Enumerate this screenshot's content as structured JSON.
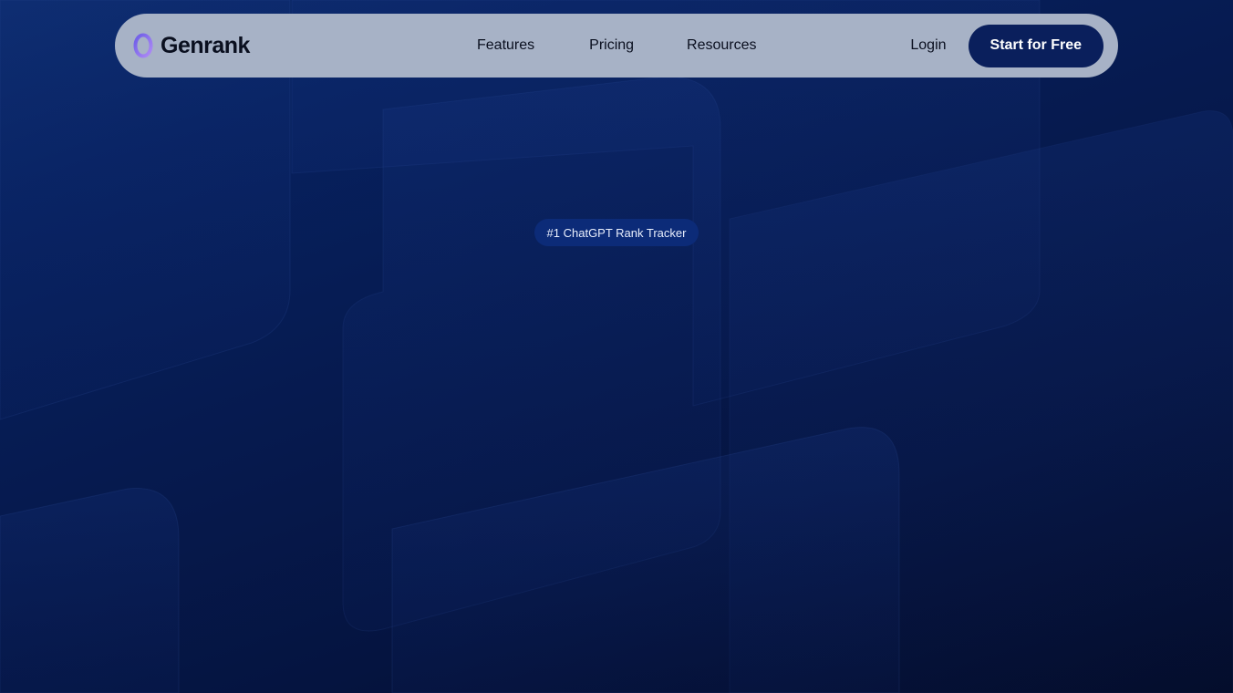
{
  "brand": {
    "name": "Genrank",
    "logo_icon": "ring-logo-icon",
    "logo_colors": [
      "#6c5ce7",
      "#a07cf0"
    ]
  },
  "nav": {
    "links": [
      {
        "label": "Features"
      },
      {
        "label": "Pricing"
      },
      {
        "label": "Resources"
      }
    ],
    "login_label": "Login",
    "cta_label": "Start for Free"
  },
  "hero": {
    "badge": "#1 ChatGPT Rank Tracker"
  },
  "colors": {
    "background": "#061a4f",
    "navbar": "#a7b2c6",
    "cta": "#0a1f5c",
    "badge": "#0c2b78"
  }
}
